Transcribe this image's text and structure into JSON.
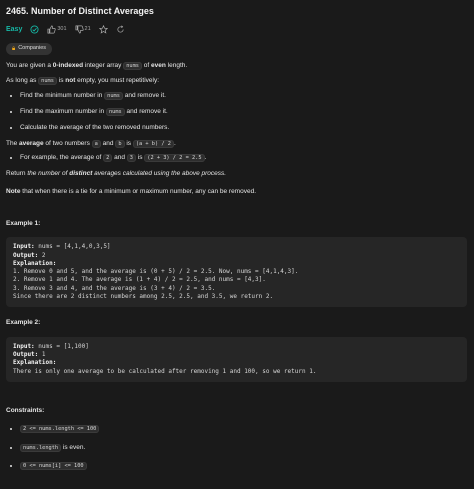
{
  "problem": {
    "title": "2465. Number of Distinct Averages",
    "difficulty": "Easy",
    "likes": "301",
    "dislikes": "21",
    "company_tag": "Companies"
  },
  "description": {
    "p1_a": "You are given a ",
    "p1_b": "0-indexed",
    "p1_c": " integer array ",
    "p1_code": "nums",
    "p1_d": " of ",
    "p1_e": "even",
    "p1_f": " length.",
    "p2_a": "As long as ",
    "p2_code": "nums",
    "p2_b": " is ",
    "p2_c": "not",
    "p2_d": " empty, you must repetitively:",
    "steps": [
      {
        "a": "Find the minimum number in ",
        "code": "nums",
        "b": " and remove it."
      },
      {
        "a": "Find the maximum number in ",
        "code": "nums",
        "b": " and remove it."
      },
      {
        "a": "Calculate the average of the two removed numbers.",
        "code": "",
        "b": ""
      }
    ],
    "p3_a": "The ",
    "p3_b": "average",
    "p3_c": " of two numbers ",
    "p3_code1": "a",
    "p3_d": " and ",
    "p3_code2": "b",
    "p3_e": " is ",
    "p3_code3": "(a + b) / 2",
    "p3_f": ".",
    "ex_a": "For example, the average of ",
    "ex_code1": "2",
    "ex_b": " and ",
    "ex_code2": "3",
    "ex_c": " is ",
    "ex_code3": "(2 + 3) / 2 = 2.5",
    "ex_d": ".",
    "p4_a": "Return ",
    "p4_b": "the number of ",
    "p4_c": "distinct",
    "p4_d": " averages calculated using the above process.",
    "p5_a": "Note",
    "p5_b": " that when there is a tie for a minimum or maximum number, any can be removed."
  },
  "examples": [
    {
      "heading": "Example 1:",
      "input_label": "Input:",
      "input": " nums = [4,1,4,0,3,5]",
      "output_label": "Output:",
      "output": " 2",
      "explanation_label": "Explanation:",
      "lines": [
        "1. Remove 0 and 5, and the average is (0 + 5) / 2 = 2.5. Now, nums = [4,1,4,3].",
        "2. Remove 1 and 4. The average is (1 + 4) / 2 = 2.5, and nums = [4,3].",
        "3. Remove 3 and 4, and the average is (3 + 4) / 2 = 3.5.",
        "Since there are 2 distinct numbers among 2.5, 2.5, and 3.5, we return 2."
      ]
    },
    {
      "heading": "Example 2:",
      "input_label": "Input:",
      "input": " nums = [1,100]",
      "output_label": "Output:",
      "output": " 1",
      "explanation_label": "Explanation:",
      "lines": [
        "There is only one average to be calculated after removing 1 and 100, so we return 1."
      ]
    }
  ],
  "constraints": {
    "heading": "Constraints:",
    "c1_code": "2 <= nums.length <= 100",
    "c2_code": "nums.length",
    "c2_text": " is even.",
    "c3_code": "0 <= nums[i] <= 100"
  },
  "colors": {
    "easy": "#16b8a6",
    "lock": "#f0a818",
    "background": "#1a1a1a"
  }
}
